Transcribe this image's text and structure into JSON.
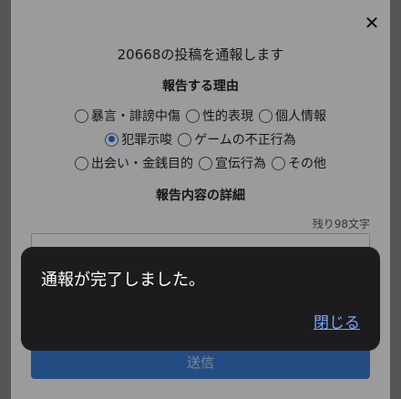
{
  "dialog": {
    "close_glyph": "✕",
    "post_title": "20668の投稿を通報します",
    "reason_heading": "報告する理由",
    "reasons": [
      {
        "label": "暴言・誹謗中傷",
        "checked": false
      },
      {
        "label": "性的表現",
        "checked": false
      },
      {
        "label": "個人情報",
        "checked": false
      },
      {
        "label": "犯罪示唆",
        "checked": true
      },
      {
        "label": "ゲームの不正行為",
        "checked": false
      },
      {
        "label": "出会い・金銭目的",
        "checked": false
      },
      {
        "label": "宣伝行為",
        "checked": false
      },
      {
        "label": "その他",
        "checked": false
      }
    ],
    "detail_heading": "報告内容の詳細",
    "remaining": "残り98文字",
    "detail_value": "",
    "submit_label": "送信"
  },
  "toast": {
    "message": "通報が完了しました。",
    "close_label": "閉じる"
  },
  "colors": {
    "accent": "#2f6fd6",
    "submit": "#3a7bd5",
    "toast_bg": "#1c1c1e",
    "toast_link": "#7aa7f5"
  }
}
